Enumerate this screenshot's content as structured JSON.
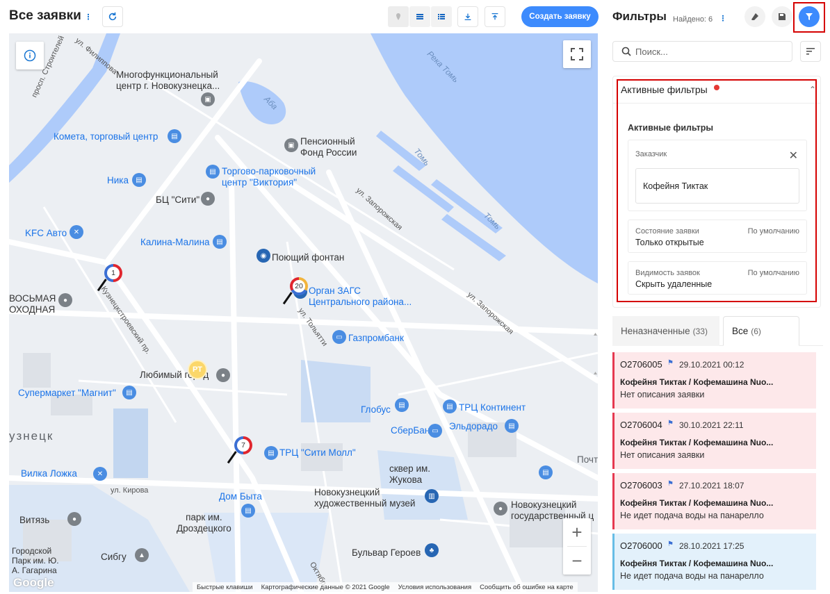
{
  "header": {
    "title": "Все заявки",
    "create_button": "Создать заявку"
  },
  "map": {
    "labels": {
      "mfc": "Многофункциональный\nцентр г. Новокузнецка...",
      "kometa": "Комета, торговый центр",
      "pension": "Пенсионный\nФонд России",
      "viktoria": "Торгово-парковочный\nцентр \"Виктория\"",
      "nika": "Ника",
      "bc_siti": "БЦ \"Сити\"",
      "kfc": "KFC Авто",
      "kalina": "Калина-Малина",
      "fontan": "Поющий фонтан",
      "zags": "Орган ЗАГС\nЦентрального района...",
      "vosmaya": "ВОСЬМАЯ\nОХОДНАЯ",
      "gazprom": "Газпромбанк",
      "lubimy": "Любимый город",
      "magnit": "Супермаркет \"Магнит\"",
      "globus": "Глобус",
      "trc_kontinent": "ТРЦ Континент",
      "eldorado": "Эльдорадо",
      "sberbank": "СберБанк",
      "kuznetsk": "узнецк",
      "trc_siti": "ТРЦ \"Сити Молл\"",
      "skver": "сквер им.\nЖукова",
      "pocht": "Почт",
      "vilka": "Вилка Ложка",
      "novomuseum": "Новокузнецкий\nхудожественный музей",
      "dom_byta": "Дом Быта",
      "novo_univ": "Новокузнецкий\nгосударственный ц",
      "vityaz": "Витязь",
      "park_drozd": "парк им.\nДроздецкого",
      "gor_park": "Городской\nПарк им. Ю.\nА. Гагарина",
      "sibgu": "Сибгу",
      "bulvar": "Бульвар Героев",
      "reka_tom": "Река Томь",
      "tom1": "Томь",
      "tom2": "Томь",
      "aba": "Аба",
      "ul_zaporozh1": "ул. Запорожская",
      "ul_zaporozh2": "ул. Запорожская",
      "ul_kirova": "ул. Кирова",
      "kuzn_pr": "Кузнецкстроевский пр.",
      "ul_tolyatti": "ул. Тольятти",
      "pr_stroitel": "просп. Строителей",
      "ul_filippova": "ул. Филиппова",
      "oktyabr": "Октябр"
    },
    "clusters": [
      "1",
      "20",
      "7"
    ],
    "pt_marker": "PT",
    "footer": [
      "Быстрые клавиши",
      "Картографические данные © 2021 Google",
      "Условия использования",
      "Сообщить об ошибке на карте"
    ],
    "google": "Google"
  },
  "filters": {
    "title": "Фильтры",
    "found": "Найдено: 6",
    "search_placeholder": "Поиск...",
    "active_header": "Активные фильтры",
    "active_inner_title": "Активные фильтры",
    "customer": {
      "label": "Заказчик",
      "value": "Кофейня Тиктак"
    },
    "state": {
      "label": "Состояние заявки",
      "default": "По умолчанию",
      "value": "Только открытые"
    },
    "visibility": {
      "label": "Видимость заявок",
      "default": "По умолчанию",
      "value": "Скрыть удаленные"
    }
  },
  "tabs": [
    {
      "label": "Неназначенные",
      "count": "(33)"
    },
    {
      "label": "Все",
      "count": "(6)"
    }
  ],
  "orders": [
    {
      "id": "O2706005",
      "date": "29.10.2021 00:12",
      "title": "Кофейня Тиктак / Кофемашина Nuo...",
      "desc": "Нет описания заявки",
      "color": "#e53950"
    },
    {
      "id": "O2706004",
      "date": "30.10.2021 22:11",
      "title": "Кофейня Тиктак / Кофемашина Nuo...",
      "desc": "Нет описания заявки",
      "color": "#e53950"
    },
    {
      "id": "O2706003",
      "date": "27.10.2021 18:07",
      "title": "Кофейня Тиктак / Кофемашина Nuo...",
      "desc": "Не идет подача воды на панарелло",
      "color": "#e53950"
    },
    {
      "id": "O2706000",
      "date": "28.10.2021 17:25",
      "title": "Кофейня Тиктак / Кофемашина Nuo...",
      "desc": "Не идет подача воды на панарелло",
      "color": "#67bde6"
    }
  ],
  "colors": {
    "accent": "#3d8bfd",
    "highlight_box": "#d50000",
    "order_red": "#e53950",
    "order_blue": "#67bde6"
  },
  "icons": [
    "info-icon",
    "refresh-icon",
    "map-pin-icon",
    "list-icon",
    "detail-list-icon",
    "download-icon",
    "upload-icon",
    "eraser-icon",
    "save-icon",
    "filter-icon",
    "search-icon",
    "sort-icon",
    "close-icon",
    "chevron-up-icon",
    "fullscreen-icon",
    "flag-icon"
  ]
}
